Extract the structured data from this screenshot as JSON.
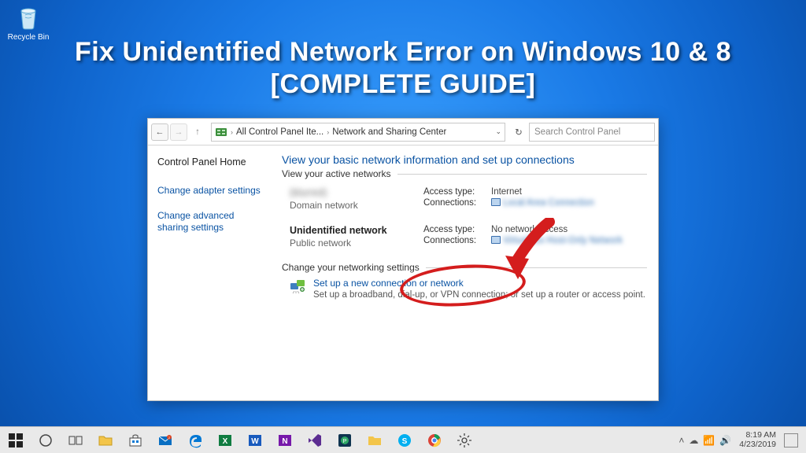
{
  "desktop": {
    "recycle_bin_label": "Recycle Bin"
  },
  "banner": {
    "line1": "Fix Unidentified Network Error on Windows 10 & 8",
    "line2": "[COMPLETE GUIDE]"
  },
  "window": {
    "breadcrumb": {
      "seg1": "All Control Panel Ite...",
      "seg2": "Network and Sharing Center"
    },
    "search_placeholder": "Search Control Panel",
    "sidebar": {
      "home": "Control Panel Home",
      "links": [
        "Change adapter settings",
        "Change advanced sharing settings"
      ]
    },
    "main": {
      "title": "View your basic network information and set up connections",
      "active_legend": "View your active networks",
      "net1": {
        "name": "(blurred)",
        "type": "Domain network",
        "access_label": "Access type:",
        "access_value": "Internet",
        "conn_label": "Connections:",
        "conn_value": "Local Area Connection"
      },
      "net2": {
        "name": "Unidentified network",
        "type": "Public network",
        "access_label": "Access type:",
        "access_value": "No network access",
        "conn_label": "Connections:",
        "conn_value": "VirtualBox Host-Only Network"
      },
      "change_legend": "Change your networking settings",
      "setup_title": "Set up a new connection or network",
      "setup_desc": "Set up a broadband, dial-up, or VPN connection; or set up a router or access point."
    }
  },
  "taskbar": {
    "time": "8:19 AM",
    "date": "4/23/2019"
  }
}
